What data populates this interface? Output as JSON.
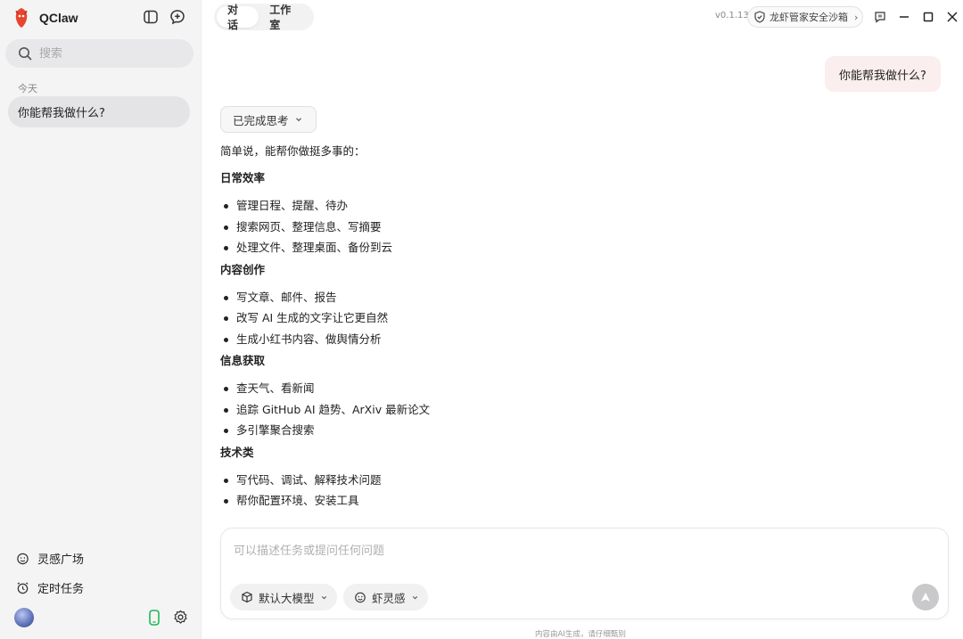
{
  "app": {
    "name": "QClaw",
    "version": "v0.1.13"
  },
  "sidebar": {
    "search_placeholder": "搜索",
    "section_today": "今天",
    "chats": [
      {
        "title": "你能帮我做什么?"
      }
    ],
    "links": [
      {
        "label": "灵感广场",
        "icon": "sparkle-face-icon"
      },
      {
        "label": "定时任务",
        "icon": "alarm-clock-icon"
      }
    ]
  },
  "tabs": [
    {
      "label": "对话",
      "active": true
    },
    {
      "label": "工作室",
      "active": false
    }
  ],
  "topbar": {
    "sandbox_label": "龙虾管家安全沙箱"
  },
  "conversation": {
    "user_message": "你能帮我做什么?",
    "thinking_label": "已完成思考",
    "answer": {
      "intro": "简单说，能帮你做挺多事的：",
      "sections": [
        {
          "title": "日常效率",
          "items": [
            "管理日程、提醒、待办",
            "搜索网页、整理信息、写摘要",
            "处理文件、整理桌面、备份到云"
          ]
        },
        {
          "title": "内容创作",
          "items": [
            "写文章、邮件、报告",
            "改写 AI 生成的文字让它更自然",
            "生成小红书内容、做舆情分析"
          ]
        },
        {
          "title": "信息获取",
          "items": [
            "查天气、看新闻",
            "追踪 GitHub AI 趋势、ArXiv 最新论文",
            "多引擎聚合搜索"
          ]
        },
        {
          "title": "技术类",
          "items": [
            "写代码、调试、解释技术问题",
            "帮你配置环境、安装工具"
          ]
        }
      ]
    }
  },
  "composer": {
    "placeholder": "可以描述任务或提问任何问题",
    "model_label": "默认大模型",
    "inspiration_label": "虾灵感"
  },
  "footer_note": "内容由AI生成，请仔细甄别",
  "colors": {
    "user_bubble": "#fbeeee",
    "sidebar_bg": "#f4f4f5",
    "accent_green": "#1db954",
    "logo_red": "#e8452f"
  }
}
